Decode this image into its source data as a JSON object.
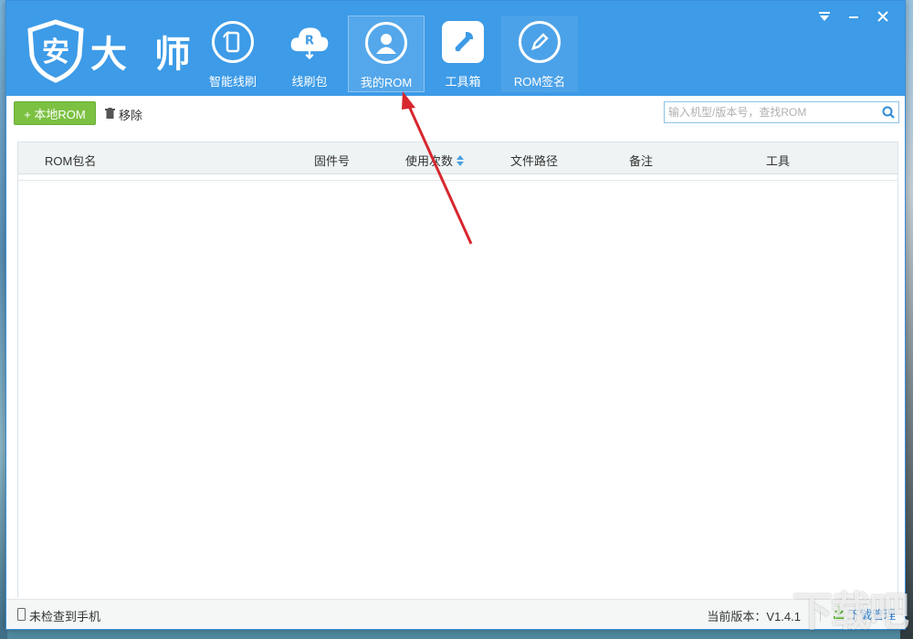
{
  "app": {
    "logo_text": "大 师",
    "logo_glyph": "安"
  },
  "nav": [
    {
      "label": "智能线刷",
      "icon": "phone-refresh-icon",
      "active": false
    },
    {
      "label": "线刷包",
      "icon": "cloud-rom-icon",
      "active": false
    },
    {
      "label": "我的ROM",
      "icon": "user-icon",
      "active": true
    },
    {
      "label": "工具箱",
      "icon": "wrench-icon",
      "active": false
    },
    {
      "label": "ROM签名",
      "icon": "pen-icon",
      "active": false
    }
  ],
  "window_controls": [
    "menu-icon",
    "minimize-icon",
    "close-icon"
  ],
  "toolbar": {
    "local_rom_label": "+ 本地ROM",
    "remove_label": "移除",
    "search_placeholder": "输入机型/版本号，查找ROM"
  },
  "table": {
    "columns": [
      "ROM包名",
      "固件号",
      "使用次数",
      "文件路径",
      "备注",
      "工具"
    ],
    "rows": []
  },
  "status": {
    "phone_status": "未检查到手机",
    "version": "当前版本：V1.4.1",
    "download_label": "下载管理"
  },
  "colors": {
    "header": "#3d9be7",
    "accent_green": "#7cc142",
    "annotation_arrow": "#d7262e"
  }
}
